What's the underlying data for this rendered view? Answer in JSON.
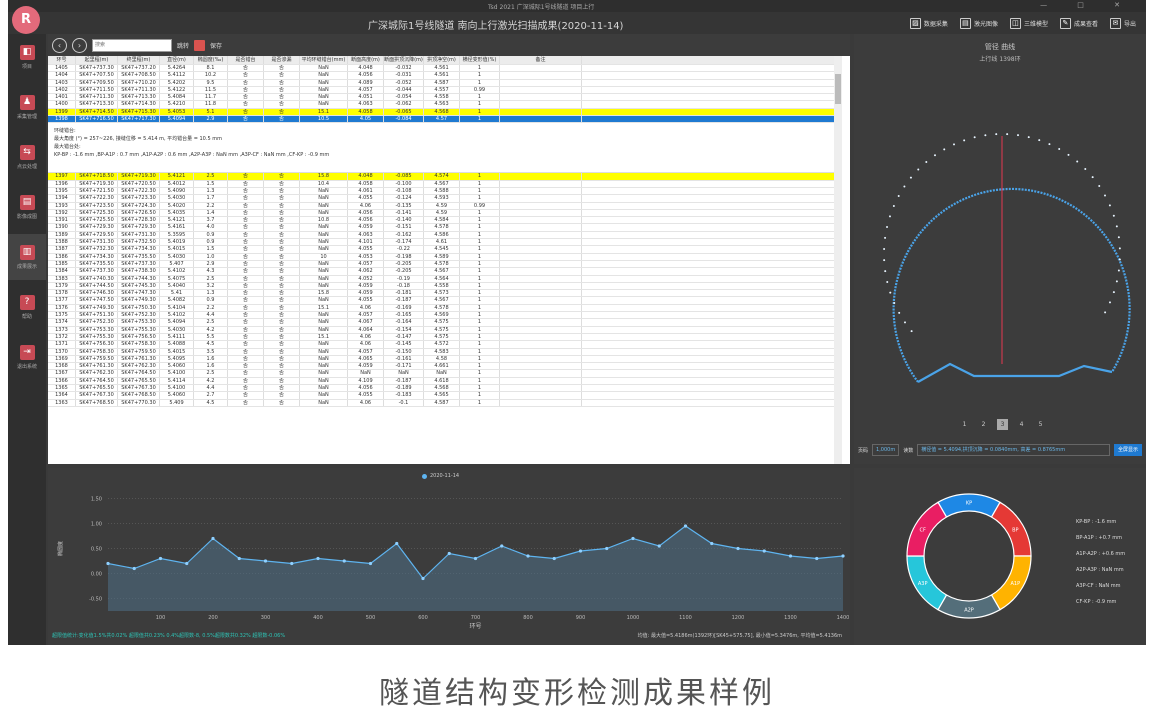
{
  "app": {
    "window_title": "Tsd 2021  广深城际1号线隧道 项目上行",
    "title": "广深城际1号线隧道 南向上行激光扫描成果(2020-11-14)",
    "logo": "R",
    "window_buttons": "—  □  ✕"
  },
  "toolbar": {
    "buttons": [
      {
        "label": "数据采集",
        "icon": "chart-icon"
      },
      {
        "label": "激光图像",
        "icon": "image-icon"
      },
      {
        "label": "三维模型",
        "icon": "cube-icon"
      },
      {
        "label": "成果查看",
        "icon": "pen-icon"
      },
      {
        "label": "导出",
        "icon": "mail-icon"
      }
    ]
  },
  "sidebar": {
    "items": [
      {
        "label": "项目",
        "icon": "◧"
      },
      {
        "label": "采集管理",
        "icon": "♟"
      },
      {
        "label": "点云处理",
        "icon": "⇆"
      },
      {
        "label": "影像成图",
        "icon": "▤"
      },
      {
        "label": "成果展示",
        "icon": "▥"
      },
      {
        "label": "帮助",
        "icon": "?"
      },
      {
        "label": "退出系统",
        "icon": "⇥"
      }
    ]
  },
  "nav": {
    "search_placeholder": "搜索",
    "jump_label": "跳转",
    "save_label": "保存"
  },
  "table": {
    "columns": [
      "环号",
      "起里程(m)",
      "终里程(m)",
      "直径(m)",
      "椭圆度(‰)",
      "是否错台",
      "是否渗漏",
      "平均环缝错台(mm)",
      "断面高度(m)",
      "断面拱顶沉降(m)",
      "拱顶净空(m)",
      "横径变形值(%)",
      "备注"
    ],
    "rows_top": [
      [
        "1405",
        "SK47+737.30",
        "SK47+737.20",
        "5.4264",
        "8.1",
        "否",
        "否",
        "NaN",
        "4.048",
        "-0.032",
        "4.561",
        "1",
        ""
      ],
      [
        "1404",
        "SK47+707.50",
        "SK47+708.50",
        "5.4112",
        "10.2",
        "否",
        "否",
        "NaN",
        "4.056",
        "-0.031",
        "4.561",
        "1",
        ""
      ],
      [
        "1403",
        "SK47+709.50",
        "SK47+710.20",
        "5.4202",
        "9.5",
        "否",
        "否",
        "NaN",
        "4.089",
        "-0.052",
        "4.587",
        "1",
        ""
      ],
      [
        "1402",
        "SK47+711.50",
        "SK47+711.30",
        "5.4122",
        "11.5",
        "否",
        "否",
        "NaN",
        "4.057",
        "-0.044",
        "4.557",
        "0.99",
        ""
      ],
      [
        "1401",
        "SK47+711.30",
        "SK47+713.30",
        "5.4084",
        "11.7",
        "否",
        "否",
        "NaN",
        "4.051",
        "-0.054",
        "4.558",
        "1",
        ""
      ],
      [
        "1400",
        "SK47+713.30",
        "SK47+714.30",
        "5.4210",
        "11.8",
        "否",
        "否",
        "NaN",
        "4.063",
        "-0.062",
        "4.563",
        "1",
        ""
      ]
    ],
    "row_yellow": [
      "1399",
      "SK47+714.50",
      "SK47+715.30",
      "5.4053",
      "5.1",
      "否",
      "否",
      "15.1",
      "4.058",
      "-0.065",
      "4.568",
      "1",
      ""
    ],
    "row_selected": [
      "1398",
      "SK47+716.50",
      "SK47+717.30",
      "5.4094",
      "2.9",
      "否",
      "否",
      "10.5",
      "4.05",
      "-0.084",
      "4.57",
      "1",
      ""
    ],
    "note_lines": [
      "环缝错台:",
      "最大角度 (°) = 257~226, 接缝位移 = 5.414 m, 平均错台量 = 10.5 mm",
      "最大错台处:",
      "KP-BP : -1.6 mm ,BP-A1P : 0.7 mm ,A1P-A2P : 0.6 mm ,A2P-A3P : NaN mm ,A3P-CF : NaN mm ,CF-KP : -0.9 mm"
    ],
    "row_yellow2": [
      "1397",
      "SK47+718.50",
      "SK47+719.30",
      "5.4121",
      "2.5",
      "否",
      "否",
      "15.8",
      "4.048",
      "-0.085",
      "4.574",
      "1",
      ""
    ],
    "rows_bottom": [
      [
        "1396",
        "SK47+719.30",
        "SK47+720.50",
        "5.4012",
        "1.5",
        "否",
        "否",
        "10.4",
        "4.058",
        "-0.100",
        "4.567",
        "1",
        ""
      ],
      [
        "1395",
        "SK47+721.50",
        "SK47+722.30",
        "5.4090",
        "1.3",
        "否",
        "否",
        "NaN",
        "4.061",
        "-0.108",
        "4.588",
        "1",
        ""
      ],
      [
        "1394",
        "SK47+722.30",
        "SK47+723.30",
        "5.4030",
        "1.7",
        "否",
        "否",
        "NaN",
        "4.055",
        "-0.124",
        "4.593",
        "1",
        ""
      ],
      [
        "1393",
        "SK47+723.50",
        "SK47+724.30",
        "5.4020",
        "2.2",
        "否",
        "否",
        "NaN",
        "4.06",
        "-0.135",
        "4.59",
        "0.99",
        ""
      ],
      [
        "1392",
        "SK47+725.30",
        "SK47+726.50",
        "5.4035",
        "1.4",
        "否",
        "否",
        "NaN",
        "4.056",
        "-0.141",
        "4.59",
        "1",
        ""
      ],
      [
        "1391",
        "SK47+725.50",
        "SK47+728.30",
        "5.4121",
        "3.7",
        "否",
        "否",
        "10.8",
        "4.056",
        "-0.140",
        "4.584",
        "1",
        ""
      ],
      [
        "1390",
        "SK47+729.30",
        "SK47+729.30",
        "5.4161",
        "4.0",
        "否",
        "否",
        "NaN",
        "4.059",
        "-0.151",
        "4.578",
        "1",
        ""
      ],
      [
        "1389",
        "SK47+729.50",
        "SK47+731.30",
        "5.3595",
        "0.9",
        "否",
        "否",
        "NaN",
        "4.063",
        "-0.162",
        "4.586",
        "1",
        ""
      ],
      [
        "1388",
        "SK47+731.30",
        "SK47+732.50",
        "5.4019",
        "0.9",
        "否",
        "否",
        "NaN",
        "4.101",
        "-0.174",
        "4.61",
        "1",
        ""
      ],
      [
        "1387",
        "SK47+732.30",
        "SK47+734.30",
        "5.4015",
        "1.5",
        "否",
        "否",
        "NaN",
        "4.055",
        "-0.22",
        "4.545",
        "1",
        ""
      ],
      [
        "1386",
        "SK47+734.30",
        "SK47+735.50",
        "5.4030",
        "1.0",
        "否",
        "否",
        "10",
        "4.053",
        "-0.198",
        "4.589",
        "1",
        ""
      ],
      [
        "1385",
        "SK47+735.50",
        "SK47+737.30",
        "5.407",
        "2.9",
        "否",
        "否",
        "NaN",
        "4.057",
        "-0.205",
        "4.578",
        "1",
        ""
      ],
      [
        "1384",
        "SK47+737.30",
        "SK47+738.30",
        "5.4102",
        "4.3",
        "否",
        "否",
        "NaN",
        "4.062",
        "-0.205",
        "4.567",
        "1",
        ""
      ],
      [
        "1383",
        "SK47+740.30",
        "SK47+744.30",
        "5.4075",
        "2.5",
        "否",
        "否",
        "NaN",
        "4.052",
        "-0.19",
        "4.564",
        "1",
        ""
      ],
      [
        "1379",
        "SK47+744.50",
        "SK47+745.30",
        "5.4040",
        "3.2",
        "否",
        "否",
        "NaN",
        "4.059",
        "-0.18",
        "4.558",
        "1",
        ""
      ],
      [
        "1378",
        "SK47+746.30",
        "SK47+747.30",
        "5.41",
        "1.3",
        "否",
        "否",
        "15.8",
        "4.059",
        "-0.181",
        "4.573",
        "1",
        ""
      ],
      [
        "1377",
        "SK47+747.50",
        "SK47+749.30",
        "5.4082",
        "0.9",
        "否",
        "否",
        "NaN",
        "4.055",
        "-0.187",
        "4.567",
        "1",
        ""
      ],
      [
        "1376",
        "SK47+749.30",
        "SK47+750.30",
        "5.4104",
        "2.2",
        "否",
        "否",
        "15.1",
        "4.06",
        "-0.169",
        "4.578",
        "1",
        ""
      ],
      [
        "1375",
        "SK47+751.30",
        "SK47+752.30",
        "5.4102",
        "4.4",
        "否",
        "否",
        "NaN",
        "4.057",
        "-0.165",
        "4.569",
        "1",
        ""
      ],
      [
        "1374",
        "SK47+752.30",
        "SK47+753.30",
        "5.4094",
        "2.5",
        "否",
        "否",
        "NaN",
        "4.067",
        "-0.164",
        "4.575",
        "1",
        ""
      ],
      [
        "1373",
        "SK47+753.30",
        "SK47+755.30",
        "5.4030",
        "4.2",
        "否",
        "否",
        "NaN",
        "4.064",
        "-0.154",
        "4.575",
        "1",
        ""
      ],
      [
        "1372",
        "SK47+755.30",
        "SK47+756.50",
        "5.4111",
        "5.5",
        "否",
        "否",
        "15.1",
        "4.06",
        "-0.147",
        "4.575",
        "1",
        ""
      ],
      [
        "1371",
        "SK47+756.30",
        "SK47+758.30",
        "5.4088",
        "4.5",
        "否",
        "否",
        "NaN",
        "4.06",
        "-0.145",
        "4.572",
        "1",
        ""
      ],
      [
        "1370",
        "SK47+758.30",
        "SK47+759.50",
        "5.4015",
        "3.5",
        "否",
        "否",
        "NaN",
        "4.057",
        "-0.150",
        "4.583",
        "1",
        ""
      ],
      [
        "1369",
        "SK47+759.50",
        "SK47+761.30",
        "5.4095",
        "1.6",
        "否",
        "否",
        "NaN",
        "4.065",
        "-0.161",
        "4.58",
        "1",
        ""
      ],
      [
        "1368",
        "SK47+761.30",
        "SK47+762.30",
        "5.4060",
        "1.6",
        "否",
        "否",
        "NaN",
        "4.059",
        "-0.171",
        "4.661",
        "1",
        ""
      ],
      [
        "1367",
        "SK47+762.30",
        "SK47+764.50",
        "5.4100",
        "2.5",
        "否",
        "否",
        "NaN",
        "NaN",
        "NaN",
        "NaN",
        "1",
        ""
      ],
      [
        "1366",
        "SK47+764.50",
        "SK47+765.50",
        "5.4114",
        "4.2",
        "否",
        "否",
        "NaN",
        "4.109",
        "-0.187",
        "4.618",
        "1",
        ""
      ],
      [
        "1365",
        "SK47+765.50",
        "SK47+767.30",
        "5.4100",
        "4.4",
        "否",
        "否",
        "NaN",
        "4.056",
        "-0.189",
        "4.568",
        "1",
        ""
      ],
      [
        "1364",
        "SK47+767.30",
        "SK47+768.50",
        "5.4060",
        "2.7",
        "否",
        "否",
        "NaN",
        "4.055",
        "-0.183",
        "4.565",
        "1",
        ""
      ],
      [
        "1363",
        "SK47+768.50",
        "SK47+770.30",
        "5.409",
        "4.5",
        "否",
        "否",
        "NaN",
        "4.06",
        "-0.1",
        "4.587",
        "1",
        ""
      ]
    ]
  },
  "profile": {
    "title": "管径 曲线",
    "subtitle": "上行线 1398环",
    "pages": [
      "1",
      "2",
      "3",
      "4",
      "5"
    ],
    "current_page": "3",
    "ctrl_label": "页码",
    "ctrl_value": "1,000m",
    "ctrl_label2": "读数",
    "ctrl_value2": "横径值 = 5.4094,拱顶沉降 = 0.0840mm, 高差 = 0.8765mm",
    "ctrl_btn": "全屏显示"
  },
  "series_chart": {
    "legend": "2020-11-14",
    "ylabel": "椭圆度",
    "xlabel": "环号",
    "yticks": [
      "1.50",
      "1.00",
      "0.50",
      "0.00",
      "-0.50"
    ],
    "xticks": [
      "100",
      "200",
      "300",
      "400",
      "500",
      "600",
      "700",
      "800",
      "900",
      "1000",
      "1100",
      "1200",
      "1300",
      "1400"
    ],
    "stats_left": "超限值统计:变化值1.5%共0.02%  超限值共0.23%  0.4%超限数-8,  0.5%超限数共0.32%  超限数-0.06%",
    "stats_right": "均值: 最大值=5.4186m(1392环)[SK45+575.75],  最小值=5.3476m,  平均值=5.4136m"
  },
  "chart_data": [
    {
      "type": "line",
      "title": "",
      "legend": [
        "2020-11-14"
      ],
      "xlabel": "环号",
      "ylabel": "椭圆度",
      "xlim": [
        0,
        1400
      ],
      "ylim": [
        -0.75,
        1.75
      ],
      "x": [
        0,
        50,
        100,
        150,
        200,
        250,
        300,
        350,
        400,
        450,
        500,
        550,
        600,
        650,
        700,
        750,
        800,
        850,
        900,
        950,
        1000,
        1050,
        1100,
        1150,
        1200,
        1250,
        1300,
        1350,
        1400
      ],
      "series": [
        {
          "name": "2020-11-14",
          "values": [
            0.2,
            0.1,
            0.3,
            0.2,
            0.7,
            0.3,
            0.25,
            0.2,
            0.3,
            0.25,
            0.2,
            0.6,
            -0.1,
            0.4,
            0.3,
            0.55,
            0.35,
            0.3,
            0.45,
            0.5,
            0.7,
            0.55,
            0.95,
            0.6,
            0.5,
            0.45,
            0.35,
            0.3,
            0.35
          ]
        }
      ]
    },
    {
      "type": "pie",
      "title": "",
      "categories": [
        "KP-BP",
        "BP-A1P",
        "A1P-A2P",
        "A2P-A3P",
        "A3P-CF",
        "CF-KP"
      ],
      "values": [
        1,
        1,
        1,
        1,
        1,
        1
      ],
      "colors": [
        "#1e88e5",
        "#e53935",
        "#ffb300",
        "#546e7a",
        "#26c6da",
        "#e91e63"
      ],
      "legend_values": [
        "-1.6 mm",
        "+0.7 mm",
        "+0.6 mm",
        "NaN mm",
        "NaN mm",
        "-0.9 mm"
      ],
      "slice_labels": [
        "KP",
        "BP",
        "A1P",
        "A2P",
        "A3P",
        "CF"
      ]
    }
  ],
  "caption": "隧道结构变形检测成果样例"
}
